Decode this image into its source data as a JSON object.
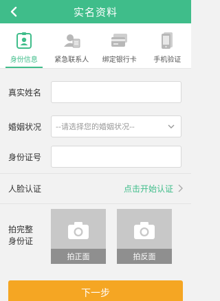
{
  "header": {
    "title": "实名资料",
    "back_icon": "chevron-left-icon"
  },
  "steps": [
    {
      "label": "身份信息",
      "icon": "id-badge-icon",
      "active": true
    },
    {
      "label": "紧急联系人",
      "icon": "contacts-icon",
      "active": false
    },
    {
      "label": "绑定银行卡",
      "icon": "bank-card-icon",
      "active": false
    },
    {
      "label": "手机验证",
      "icon": "phone-icon",
      "active": false
    }
  ],
  "form": {
    "name_label": "真实姓名",
    "name_value": "",
    "marital_label": "婚姻状况",
    "marital_placeholder": "--请选择您的婚姻状况--",
    "id_label": "身份证号",
    "id_value": ""
  },
  "face": {
    "label": "人脸认证",
    "action": "点击开始认证"
  },
  "id_photos": {
    "label": "拍完整身份证",
    "front_caption": "拍正面",
    "back_caption": "拍反面"
  },
  "next_button": "下一步",
  "colors": {
    "primary": "#3fbd8a",
    "accent": "#f5a623",
    "background": "#f2f2f2"
  }
}
